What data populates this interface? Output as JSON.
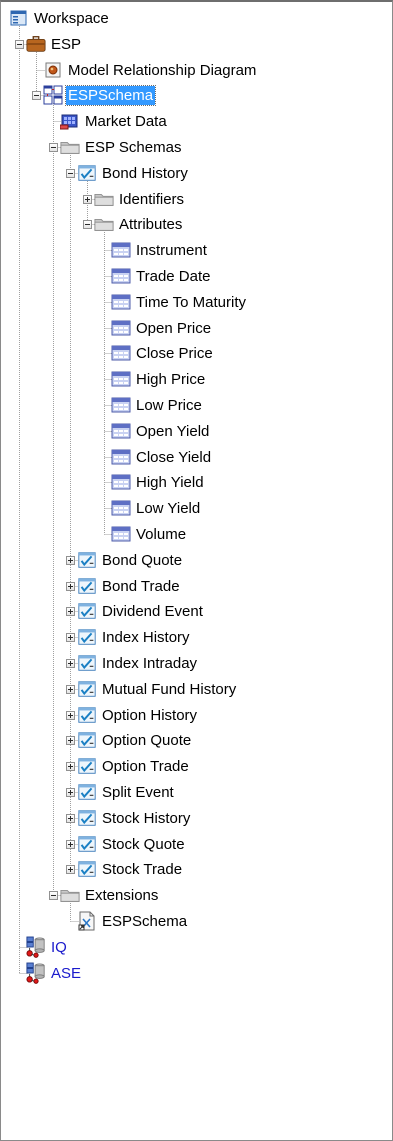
{
  "tree": {
    "nodes": [
      {
        "id": "workspace",
        "label": "Workspace",
        "icon": "workspace-icon",
        "level": 0,
        "expander": "none"
      },
      {
        "id": "esp",
        "label": "ESP",
        "icon": "briefcase-icon",
        "level": 1,
        "expander": "expanded"
      },
      {
        "id": "model-relationship-diagram",
        "label": "Model Relationship Diagram",
        "icon": "diagram-icon",
        "level": 2,
        "expander": "none"
      },
      {
        "id": "espschema",
        "label": "ESPSchema",
        "icon": "schema-icon",
        "level": 2,
        "expander": "expanded",
        "selected": true
      },
      {
        "id": "market-data",
        "label": "Market Data",
        "icon": "market-data-icon",
        "level": 3,
        "expander": "none"
      },
      {
        "id": "esp-schemas",
        "label": "ESP Schemas",
        "icon": "folder-icon",
        "level": 3,
        "expander": "expanded"
      },
      {
        "id": "bond-history",
        "label": "Bond History",
        "icon": "checklist-icon",
        "level": 4,
        "expander": "expanded"
      },
      {
        "id": "identifiers",
        "label": "Identifiers",
        "icon": "folder-icon",
        "level": 5,
        "expander": "collapsed"
      },
      {
        "id": "attributes",
        "label": "Attributes",
        "icon": "folder-icon",
        "level": 5,
        "expander": "expanded"
      },
      {
        "id": "instrument",
        "label": "Instrument",
        "icon": "attribute-icon",
        "level": 6,
        "expander": "none"
      },
      {
        "id": "trade-date",
        "label": "Trade Date",
        "icon": "attribute-icon",
        "level": 6,
        "expander": "none"
      },
      {
        "id": "time-to-maturity",
        "label": "Time To Maturity",
        "icon": "attribute-icon",
        "level": 6,
        "expander": "none"
      },
      {
        "id": "open-price",
        "label": "Open Price",
        "icon": "attribute-icon",
        "level": 6,
        "expander": "none"
      },
      {
        "id": "close-price",
        "label": "Close Price",
        "icon": "attribute-icon",
        "level": 6,
        "expander": "none"
      },
      {
        "id": "high-price",
        "label": "High Price",
        "icon": "attribute-icon",
        "level": 6,
        "expander": "none"
      },
      {
        "id": "low-price",
        "label": "Low Price",
        "icon": "attribute-icon",
        "level": 6,
        "expander": "none"
      },
      {
        "id": "open-yield",
        "label": "Open Yield",
        "icon": "attribute-icon",
        "level": 6,
        "expander": "none"
      },
      {
        "id": "close-yield",
        "label": "Close Yield",
        "icon": "attribute-icon",
        "level": 6,
        "expander": "none"
      },
      {
        "id": "high-yield",
        "label": "High Yield",
        "icon": "attribute-icon",
        "level": 6,
        "expander": "none"
      },
      {
        "id": "low-yield",
        "label": "Low Yield",
        "icon": "attribute-icon",
        "level": 6,
        "expander": "none"
      },
      {
        "id": "volume",
        "label": "Volume",
        "icon": "attribute-icon",
        "level": 6,
        "expander": "none"
      },
      {
        "id": "bond-quote",
        "label": "Bond Quote",
        "icon": "checklist-icon",
        "level": 4,
        "expander": "collapsed"
      },
      {
        "id": "bond-trade",
        "label": "Bond Trade",
        "icon": "checklist-icon",
        "level": 4,
        "expander": "collapsed"
      },
      {
        "id": "dividend-event",
        "label": "Dividend Event",
        "icon": "checklist-icon",
        "level": 4,
        "expander": "collapsed"
      },
      {
        "id": "index-history",
        "label": "Index History",
        "icon": "checklist-icon",
        "level": 4,
        "expander": "collapsed"
      },
      {
        "id": "index-intraday",
        "label": "Index Intraday",
        "icon": "checklist-icon",
        "level": 4,
        "expander": "collapsed"
      },
      {
        "id": "mutual-fund-history",
        "label": "Mutual Fund History",
        "icon": "checklist-icon",
        "level": 4,
        "expander": "collapsed"
      },
      {
        "id": "option-history",
        "label": "Option History",
        "icon": "checklist-icon",
        "level": 4,
        "expander": "collapsed"
      },
      {
        "id": "option-quote",
        "label": "Option Quote",
        "icon": "checklist-icon",
        "level": 4,
        "expander": "collapsed"
      },
      {
        "id": "option-trade",
        "label": "Option Trade",
        "icon": "checklist-icon",
        "level": 4,
        "expander": "collapsed"
      },
      {
        "id": "split-event",
        "label": "Split Event",
        "icon": "checklist-icon",
        "level": 4,
        "expander": "collapsed"
      },
      {
        "id": "stock-history",
        "label": "Stock History",
        "icon": "checklist-icon",
        "level": 4,
        "expander": "collapsed"
      },
      {
        "id": "stock-quote",
        "label": "Stock Quote",
        "icon": "checklist-icon",
        "level": 4,
        "expander": "collapsed"
      },
      {
        "id": "stock-trade",
        "label": "Stock Trade",
        "icon": "checklist-icon",
        "level": 4,
        "expander": "collapsed"
      },
      {
        "id": "extensions",
        "label": "Extensions",
        "icon": "folder-icon",
        "level": 3,
        "expander": "expanded"
      },
      {
        "id": "extension-espschema",
        "label": "ESPSchema",
        "icon": "extension-file-icon",
        "level": 4,
        "expander": "none"
      },
      {
        "id": "iq",
        "label": "IQ",
        "icon": "database-connection-icon",
        "level": 1,
        "expander": "none",
        "blue": true
      },
      {
        "id": "ase",
        "label": "ASE",
        "icon": "database-connection-icon",
        "level": 1,
        "expander": "none",
        "blue": true
      }
    ]
  },
  "colors": {
    "selection": "#3399ff",
    "link_text": "#1a1acc",
    "tree_line": "#a0a0a0",
    "border": "#8a8a8a"
  }
}
